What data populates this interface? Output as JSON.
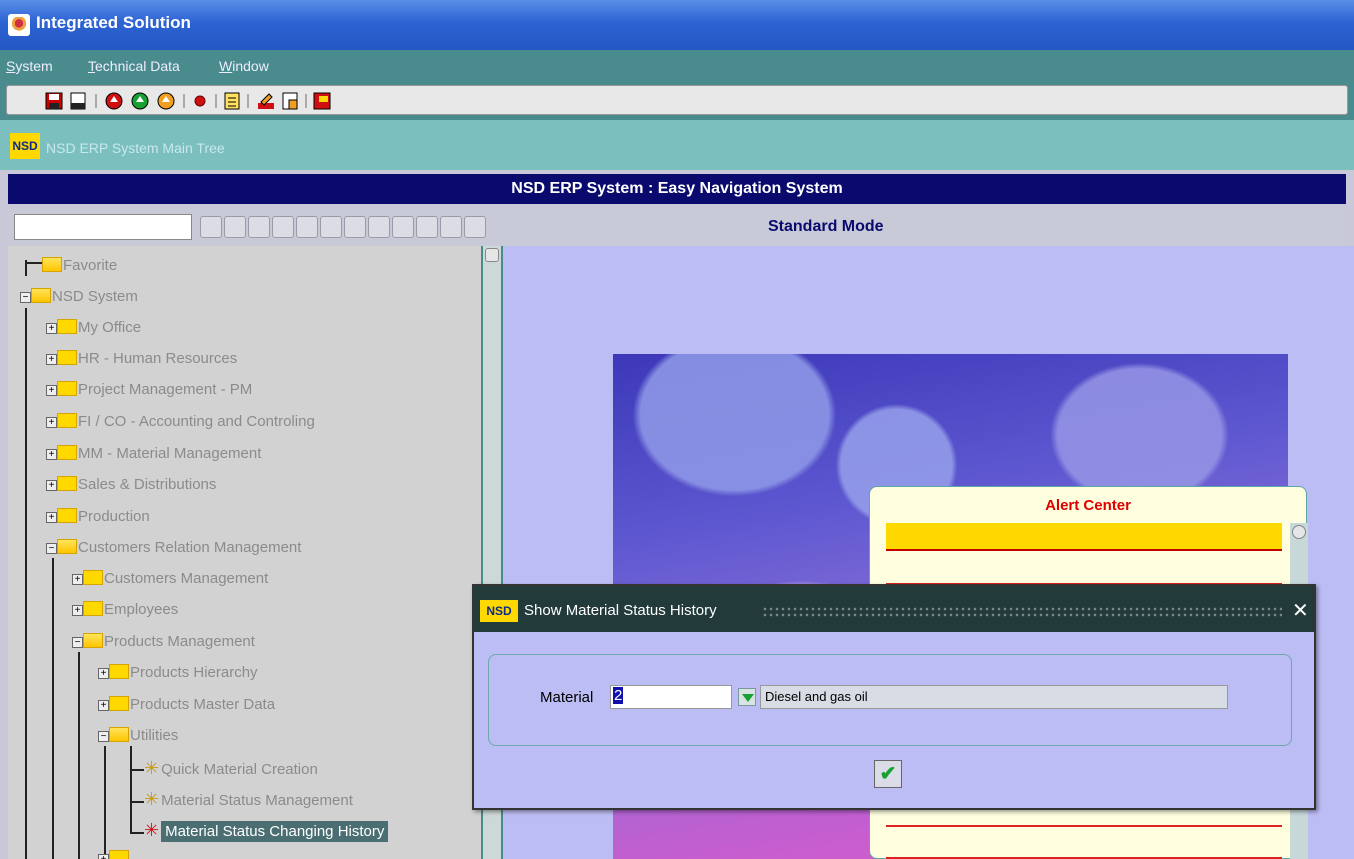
{
  "window": {
    "title": "Integrated Solution"
  },
  "menu": {
    "items": [
      "System",
      "Technical Data",
      "Window"
    ]
  },
  "toolbar": {
    "buttons": [
      "save-icon",
      "print-icon",
      "nav-red-icon",
      "nav-green-icon",
      "nav-orange-icon",
      "record-icon",
      "list-icon",
      "edit-icon",
      "attach-icon",
      "exit-icon"
    ]
  },
  "tree_header": {
    "logo": "NSD",
    "label": "NSD ERP System Main Tree"
  },
  "nav_header": {
    "title": "NSD ERP System : Easy Navigation System"
  },
  "mode_bar": {
    "mode": "Standard Mode",
    "search_value": ""
  },
  "tree": {
    "items": [
      {
        "label": "Favorite"
      },
      {
        "label": "NSD  System"
      },
      {
        "label": "My Office"
      },
      {
        "label": "HR - Human Resources"
      },
      {
        "label": "Project Management - PM"
      },
      {
        "label": "FI / CO - Accounting and Controling"
      },
      {
        "label": "MM - Material Management"
      },
      {
        "label": "Sales & Distributions"
      },
      {
        "label": "Production"
      },
      {
        "label": "Customers Relation Management"
      },
      {
        "label": "Customers Management"
      },
      {
        "label": "Employees"
      },
      {
        "label": "Products Management"
      },
      {
        "label": "Products Hierarchy"
      },
      {
        "label": "Products Master Data"
      },
      {
        "label": "Utilities"
      },
      {
        "label": "Quick Material Creation"
      },
      {
        "label": "Material Status Management"
      },
      {
        "label": "Material Status Changing History"
      }
    ]
  },
  "alert_center": {
    "title": "Alert Center"
  },
  "dialog": {
    "logo": "NSD",
    "title": "Show Material Status History",
    "material_label": "Material",
    "material_code": "2",
    "material_description": "Diesel and gas oil",
    "close_icon": "close-icon",
    "ok_icon": "checkmark-icon"
  },
  "colors": {
    "titlebar": "#2c63d2",
    "menubar": "#4a8b8d",
    "nav_header": "#0a0a6e",
    "alert_title": "#e00000",
    "highlight": "#ffd800"
  }
}
